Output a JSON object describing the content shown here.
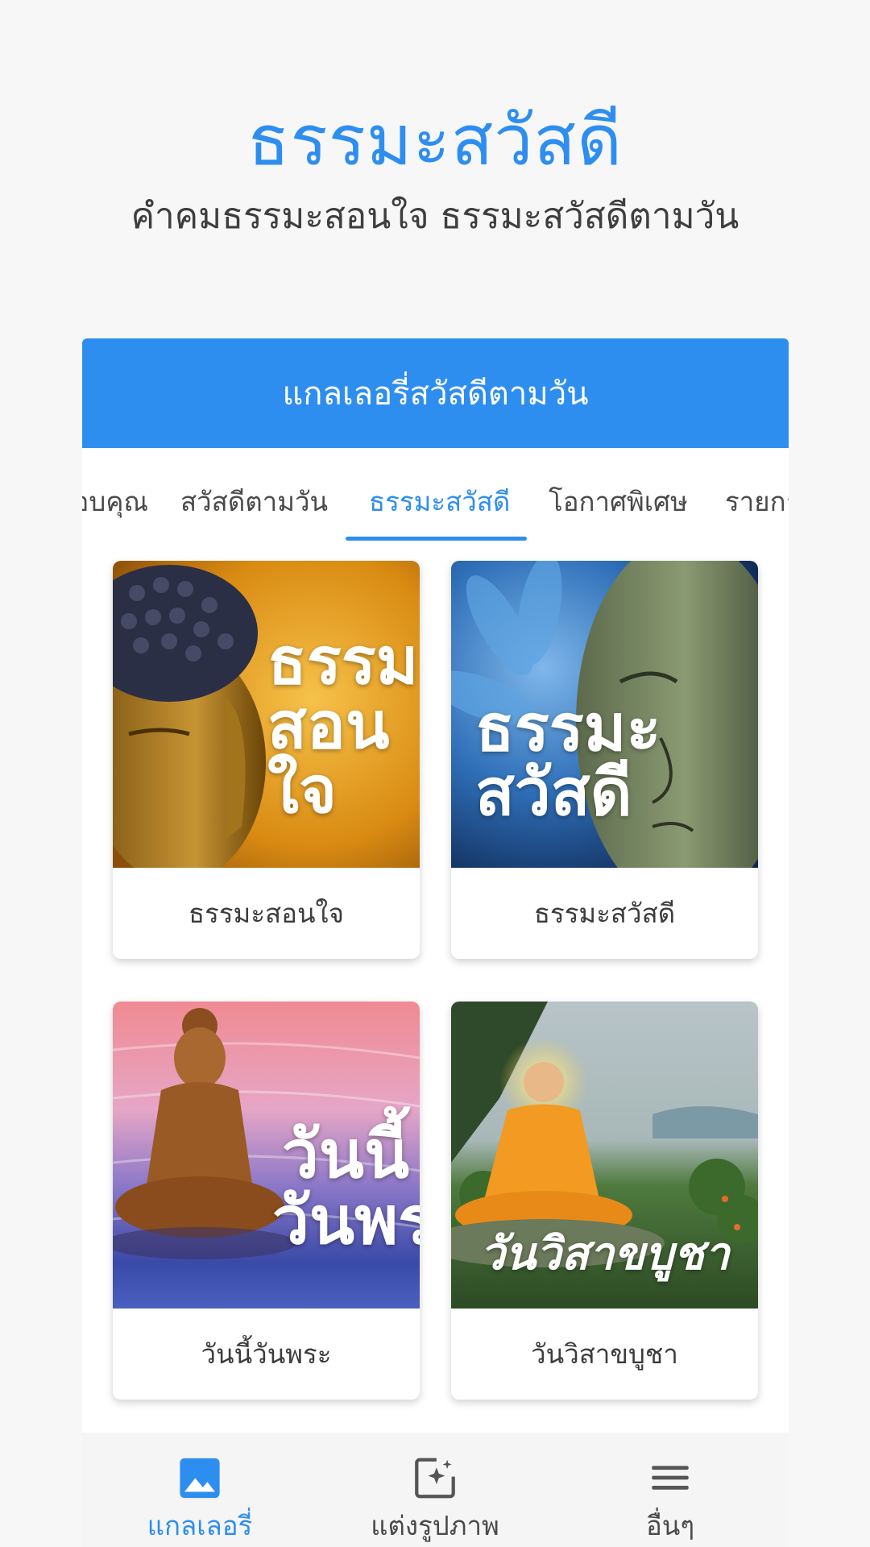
{
  "header": {
    "title": "ธรรมะสวัสดี",
    "subtitle": "คำคมธรรมะสอนใจ ธรรมะสวัสดีตามวัน"
  },
  "panel": {
    "title": "แกลเลอรี่สวัสดีตามวัน"
  },
  "tabs": [
    {
      "label": "ขอบคุณ",
      "active": false
    },
    {
      "label": "สวัสดีตามวัน",
      "active": false
    },
    {
      "label": "ธรรมะสวัสดี",
      "active": true
    },
    {
      "label": "โอกาศพิเศษ",
      "active": false
    },
    {
      "label": "รายการ",
      "active": false
    }
  ],
  "cards": [
    {
      "label": "ธรรมะสอนใจ",
      "overlay": [
        "ธรรมะ",
        "สอนใจ"
      ]
    },
    {
      "label": "ธรรมะสวัสดี",
      "overlay": [
        "ธรรมะ",
        "สวัสดี"
      ]
    },
    {
      "label": "วันนี้วันพระ",
      "overlay": [
        "วันนี้",
        "วันพระ"
      ]
    },
    {
      "label": "วันวิสาขบูชา",
      "overlay": [
        "วันวิสาขบูชา"
      ]
    }
  ],
  "bottom_nav": [
    {
      "label": "แกลเลอรี่",
      "icon": "image-icon",
      "active": true
    },
    {
      "label": "แต่งรูปภาพ",
      "icon": "edit-image-icon",
      "active": false
    },
    {
      "label": "อื่นๆ",
      "icon": "menu-icon",
      "active": false
    }
  ],
  "colors": {
    "accent": "#2e8ef0",
    "background": "#f7f7f7",
    "text": "#3e3e3e"
  }
}
